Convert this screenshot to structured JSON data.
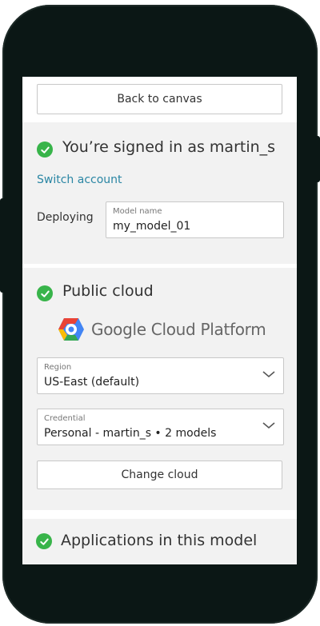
{
  "buttons": {
    "back_to_canvas": "Back to canvas",
    "change_cloud": "Change cloud"
  },
  "account": {
    "signed_in_heading": "You’re signed in as martin_s",
    "switch_account": "Switch account"
  },
  "deploy": {
    "label": "Deploying",
    "model_name_label": "Model name",
    "model_name_value": "my_model_01"
  },
  "cloud": {
    "heading": "Public cloud",
    "provider_name": "Google Cloud Platform",
    "region": {
      "label": "Region",
      "value": "US-East (default)"
    },
    "credential": {
      "label": "Credential",
      "value": "Personal - martin_s • 2 models"
    }
  },
  "apps": {
    "heading": "Applications in this model"
  },
  "colors": {
    "check_green": "#38b44a",
    "link_blue": "#2a86a4",
    "section_gray": "#f2f2f2",
    "phone_body": "#0b1715"
  },
  "icons": [
    "check-icon",
    "chevron-down-icon",
    "google-cloud-logo-icon"
  ]
}
